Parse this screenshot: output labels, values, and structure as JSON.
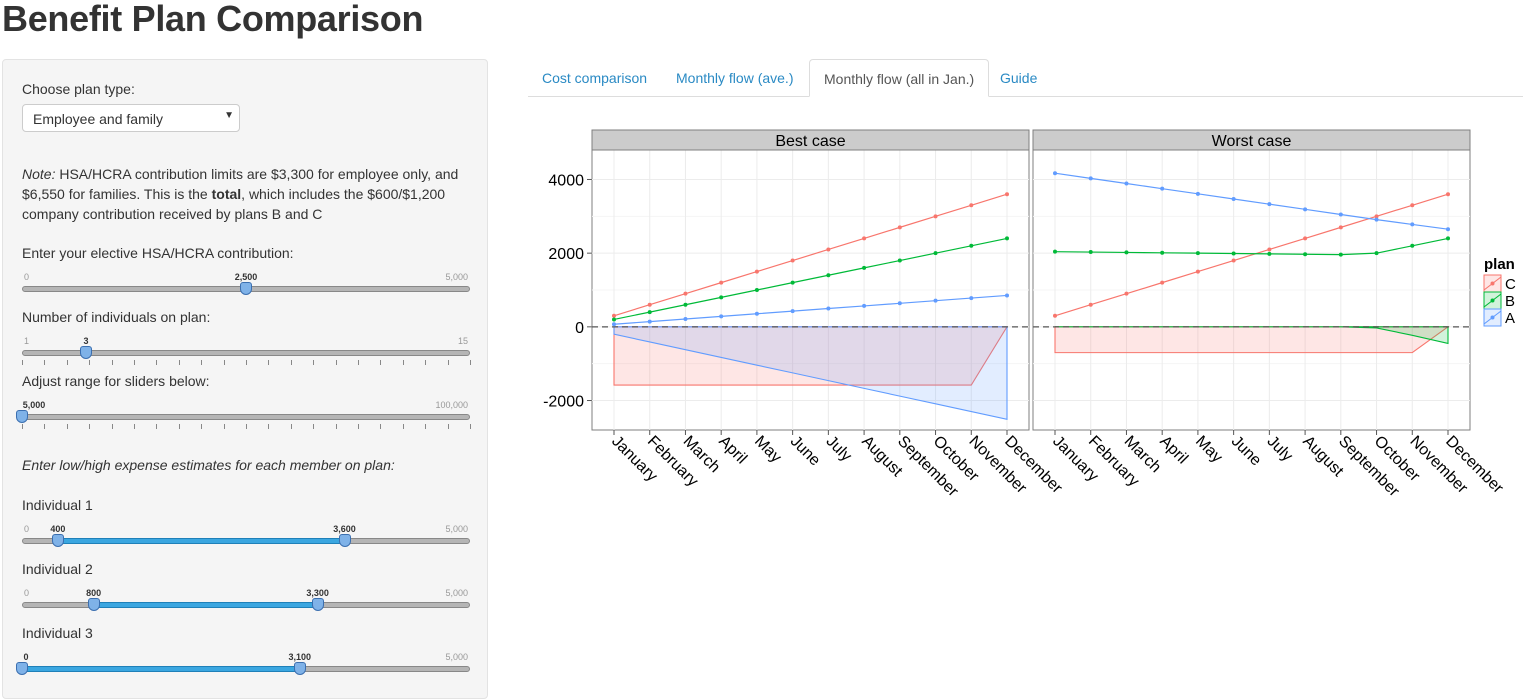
{
  "page_title": "Benefit Plan Comparison",
  "sidebar": {
    "plan_type_label": "Choose plan type:",
    "plan_type_value": "Employee and family",
    "note_prefix": "Note:",
    "note_part1": " HSA/HCRA contribution limits are $3,300 for employee only, and $6,550 for families. This is the ",
    "note_bold": "total",
    "note_part2": ", which includes the $600/$1,200 company contribution received by plans B and C",
    "hsa_label": "Enter your elective HSA/HCRA contribution:",
    "hsa_slider": {
      "min": "0",
      "max": "5,000",
      "value_label": "2,500",
      "value": 2500,
      "range": [
        0,
        5000
      ]
    },
    "individuals_label": "Number of individuals on plan:",
    "individuals_slider": {
      "min": "1",
      "max": "15",
      "value_label": "3",
      "value": 3,
      "range": [
        1,
        15
      ]
    },
    "range_label": "Adjust range for sliders below:",
    "range_slider": {
      "value_label": "5,000",
      "max": "100,000",
      "value": 5000,
      "range": [
        5000,
        100000
      ]
    },
    "expense_label": "Enter low/high expense estimates for each member on plan:",
    "individuals": [
      {
        "label": "Individual 1",
        "min": "0",
        "max": "5,000",
        "low_label": "400",
        "high_label": "3,600",
        "low": 400,
        "high": 3600
      },
      {
        "label": "Individual 2",
        "min": "0",
        "max": "5,000",
        "low_label": "800",
        "high_label": "3,300",
        "low": 800,
        "high": 3300
      },
      {
        "label": "Individual 3",
        "min": "0",
        "max": "5,000",
        "low_label": "0",
        "high_label": "3,100",
        "low": 0,
        "high": 3100
      }
    ]
  },
  "tabs": [
    {
      "label": "Cost comparison",
      "active": false
    },
    {
      "label": "Monthly flow (ave.)",
      "active": false
    },
    {
      "label": "Monthly flow (all in Jan.)",
      "active": true
    },
    {
      "label": "Guide",
      "active": false
    }
  ],
  "chart_data": {
    "type": "line",
    "categories": [
      "January",
      "February",
      "March",
      "April",
      "May",
      "June",
      "July",
      "August",
      "September",
      "October",
      "November",
      "December"
    ],
    "y_ticks": [
      -2000,
      0,
      2000,
      4000
    ],
    "ylim": [
      -2800,
      4800
    ],
    "legend_title": "plan",
    "legend_position": "right",
    "grid": true,
    "colors": {
      "C": "#f8766d",
      "B": "#00ba38",
      "A": "#619cff"
    },
    "panels": [
      {
        "title": "Best case",
        "series": [
          {
            "name": "C",
            "values": [
              300,
              600,
              900,
              1200,
              1500,
              1800,
              2100,
              2400,
              2700,
              3000,
              3300,
              3600
            ]
          },
          {
            "name": "B",
            "values": [
              200,
              400,
              600,
              800,
              1000,
              1200,
              1400,
              1600,
              1800,
              2000,
              2200,
              2400
            ]
          },
          {
            "name": "A",
            "values": [
              71,
              142,
              213,
              284,
              355,
              426,
              497,
              568,
              639,
              710,
              781,
              852
            ]
          }
        ],
        "areas": [
          {
            "name": "C",
            "values": [
              -1580,
              -1580,
              -1580,
              -1580,
              -1580,
              -1580,
              -1580,
              -1580,
              -1580,
              -1580,
              -1580,
              0
            ]
          },
          {
            "name": "A",
            "values": [
              -200,
              -410,
              -620,
              -830,
              -1040,
              -1250,
              -1460,
              -1670,
              -1880,
              -2090,
              -2300,
              -2510
            ]
          }
        ]
      },
      {
        "title": "Worst case",
        "series": [
          {
            "name": "C",
            "values": [
              300,
              600,
              900,
              1200,
              1500,
              1800,
              2100,
              2400,
              2700,
              3000,
              3300,
              3600
            ]
          },
          {
            "name": "B",
            "values": [
              2040,
              2030,
              2020,
              2010,
              2000,
              1990,
              1980,
              1970,
              1960,
              2000,
              2200,
              2400
            ]
          },
          {
            "name": "A",
            "values": [
              4170,
              4030,
              3890,
              3750,
              3610,
              3470,
              3330,
              3190,
              3050,
              2910,
              2780,
              2650
            ]
          }
        ],
        "areas": [
          {
            "name": "C",
            "values": [
              -700,
              -700,
              -700,
              -700,
              -700,
              -700,
              -700,
              -700,
              -700,
              -700,
              -700,
              0
            ]
          },
          {
            "name": "B",
            "values": [
              0,
              0,
              0,
              0,
              0,
              0,
              0,
              0,
              0,
              -30,
              -230,
              -450
            ]
          }
        ]
      }
    ]
  }
}
